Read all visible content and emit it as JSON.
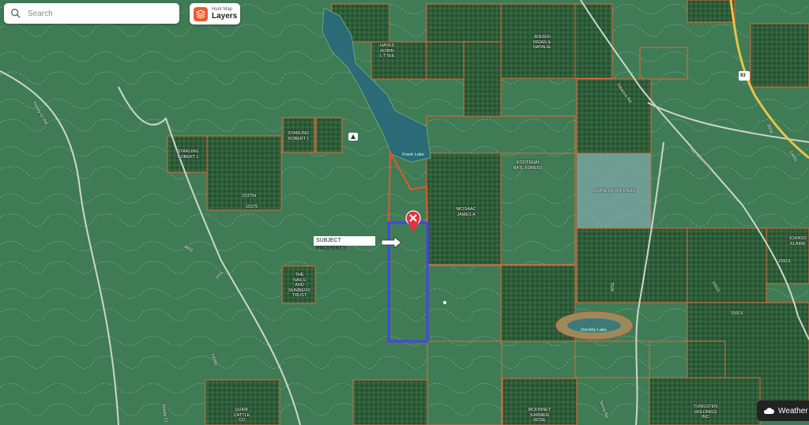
{
  "search": {
    "placeholder": "Search"
  },
  "layers_button": {
    "subtitle": "Hunt Map",
    "label": "Layers"
  },
  "weather_button": {
    "label": "Weather"
  },
  "subject_label": "SUBJECT PROPERTY",
  "parcels": [
    {
      "key": "hayes",
      "text": "HAYES\nROBIN\nL TTEE"
    },
    {
      "key": "jensen",
      "text": "JENSEN\nBRIAN &\nNATALIE"
    },
    {
      "key": "starling1",
      "text": "STARLING\nROBERT L"
    },
    {
      "key": "starling2",
      "text": "STARLING\nROBERT L"
    },
    {
      "key": "kootenai",
      "text": "KOOTENAI\nNATL FOREST"
    },
    {
      "key": "mcisaac",
      "text": "MCISAAC\nJAMES A"
    },
    {
      "key": "state",
      "text": "STATE OF MT DNRC"
    },
    {
      "key": "nails",
      "text": "THE\nNAILS\nAND\nNUMBERS\nTRUST"
    },
    {
      "key": "johnson",
      "text": "JOHNSO\nKLAIRE"
    },
    {
      "key": "quirk",
      "text": "QUIRK\nCATTLE\nCO"
    },
    {
      "key": "mckinney",
      "text": "MCKINNEY\nKARMEN\nROSE"
    },
    {
      "key": "tungsten",
      "text": "TUNGSTEN\nHOLDINGS\nINC"
    }
  ],
  "road_labels": [
    {
      "key": "r15375a",
      "text": "15375a"
    },
    {
      "key": "r15375",
      "text": "15375"
    },
    {
      "key": "r3662",
      "text": "3662"
    },
    {
      "key": "r7011",
      "text": "7011"
    },
    {
      "key": "r15919",
      "text": "15919"
    },
    {
      "key": "r3658",
      "text": "3658"
    },
    {
      "key": "r14491",
      "text": "14491"
    },
    {
      "key": "r93",
      "text": "93"
    },
    {
      "key": "r7826",
      "text": "7826"
    },
    {
      "key": "r15916",
      "text": "15916"
    },
    {
      "key": "r15915",
      "text": "15915"
    },
    {
      "key": "r14250",
      "text": "14250"
    },
    {
      "key": "thirsty",
      "text": "Thirsty Cr Rd"
    },
    {
      "key": "tobacco",
      "text": "Tobacco Rd"
    },
    {
      "key": "natl",
      "text": "Natl Access Rd"
    },
    {
      "key": "thirsty2",
      "text": "Thirsty Cr"
    },
    {
      "key": "tenna",
      "text": "Tenna Rd"
    }
  ],
  "water_labels": [
    {
      "key": "frank",
      "text": "Frank Lake"
    },
    {
      "key": "dorothy",
      "text": "Dorothy Lake"
    }
  ],
  "colors": {
    "parcel": "#e06a3c",
    "subject": "#3f3fe0",
    "pin": "#e8313f"
  }
}
